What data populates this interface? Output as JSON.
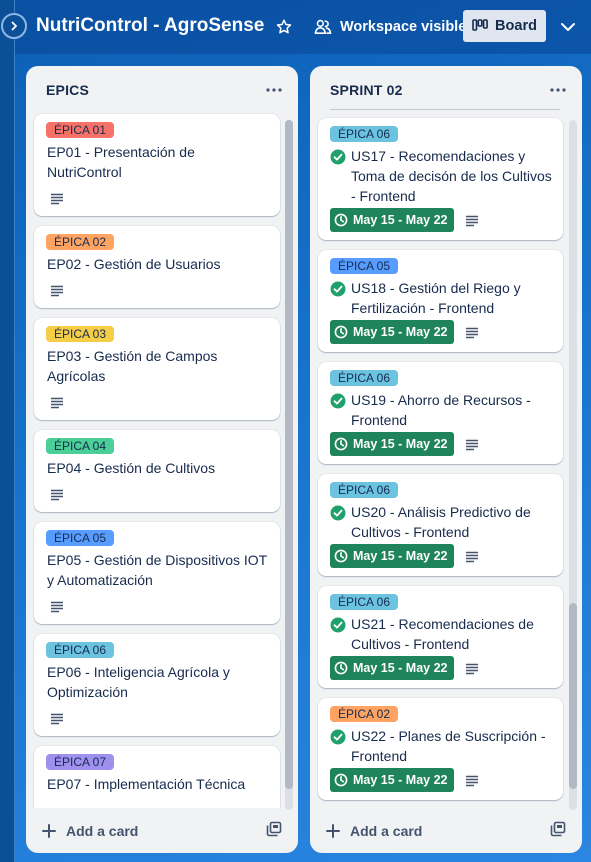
{
  "header": {
    "board_name": "NutriControl - AgroSense",
    "visibility_label": "Workspace visible",
    "view_label": "Board"
  },
  "colors": {
    "red": "#f87168",
    "orange": "#fea362",
    "yellow": "#f5cd47",
    "green": "#4bce97",
    "blue": "#579dff",
    "sky": "#6cc3e0",
    "purple": "#9f8fef",
    "date_green": "#1f845a"
  },
  "lists": {
    "epics": {
      "title": "EPICS",
      "add_card_label": "Add a card",
      "scroll_fraction_start": 0.0,
      "scroll_fraction_visible": 0.97,
      "cards": [
        {
          "label": "ÉPICA 01",
          "label_color": "red",
          "title": "EP01 - Presentación de NutriControl",
          "has_description": true
        },
        {
          "label": "ÉPICA 02",
          "label_color": "orange",
          "title": "EP02 - Gestión de Usuarios",
          "has_description": true
        },
        {
          "label": "ÉPICA 03",
          "label_color": "yellow",
          "title": "EP03 - Gestión de Campos Agrícolas",
          "has_description": true
        },
        {
          "label": "ÉPICA 04",
          "label_color": "green",
          "title": "EP04 - Gestión de Cultivos",
          "has_description": true
        },
        {
          "label": "ÉPICA 05",
          "label_color": "blue",
          "title": "EP05 - Gestión de Dispositivos IOT y Automatización",
          "has_description": true
        },
        {
          "label": "ÉPICA 06",
          "label_color": "sky",
          "title": "EP06 - Inteligencia Agrícola y Optimización",
          "has_description": true
        },
        {
          "label": "ÉPICA 07",
          "label_color": "purple",
          "title": "EP07 - Implementación Técnica",
          "has_description": true
        }
      ]
    },
    "sprint": {
      "title": "SPRINT 02",
      "add_card_label": "Add a card",
      "scroll_fraction_start": 0.7,
      "scroll_fraction_visible": 0.27,
      "cards": [
        {
          "label": "ÉPICA 06",
          "label_color": "sky",
          "title": "US17 - Recomendaciones y Toma de decisón de los Cultivos - Frontend",
          "dates": "May 15 - May 22"
        },
        {
          "label": "ÉPICA 05",
          "label_color": "blue",
          "title": "US18 - Gestión del Riego y Fertilización - Frontend",
          "dates": "May 15 - May 22"
        },
        {
          "label": "ÉPICA 06",
          "label_color": "sky",
          "title": "US19 - Ahorro de Recursos - Frontend",
          "dates": "May 15 - May 22"
        },
        {
          "label": "ÉPICA 06",
          "label_color": "sky",
          "title": "US20 - Análisis Predictivo de Cultivos - Frontend",
          "dates": "May 15 - May 22"
        },
        {
          "label": "ÉPICA 06",
          "label_color": "sky",
          "title": "US21 - Recomendaciones de Cultivos - Frontend",
          "dates": "May 15 - May 22"
        },
        {
          "label": "ÉPICA 02",
          "label_color": "orange",
          "title": "US22 - Planes de Suscripción - Frontend",
          "dates": "May 15 - May 22"
        }
      ]
    }
  }
}
